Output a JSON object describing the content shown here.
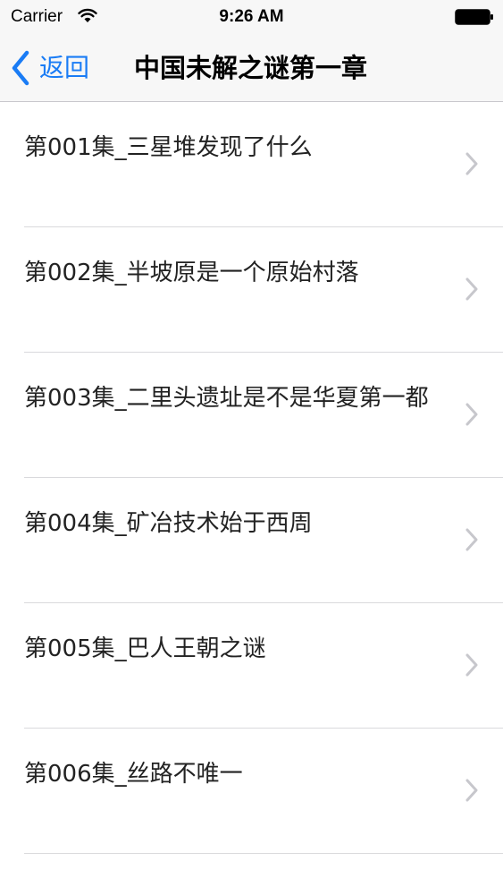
{
  "status_bar": {
    "carrier": "Carrier",
    "time": "9:26 AM",
    "icons": [
      "wifi-icon",
      "battery-icon"
    ]
  },
  "nav": {
    "back_label": "返回",
    "title": "中国未解之谜第一章",
    "accent_color": "#1a7cf5"
  },
  "list": {
    "items": [
      {
        "label": "第001集_三星堆发现了什么"
      },
      {
        "label": "第002集_半坡原是一个原始村落"
      },
      {
        "label": "第003集_二里头遗址是不是华夏第一都"
      },
      {
        "label": "第004集_矿冶技术始于西周"
      },
      {
        "label": "第005集_巴人王朝之谜"
      },
      {
        "label": "第006集_丝路不唯一"
      }
    ]
  }
}
